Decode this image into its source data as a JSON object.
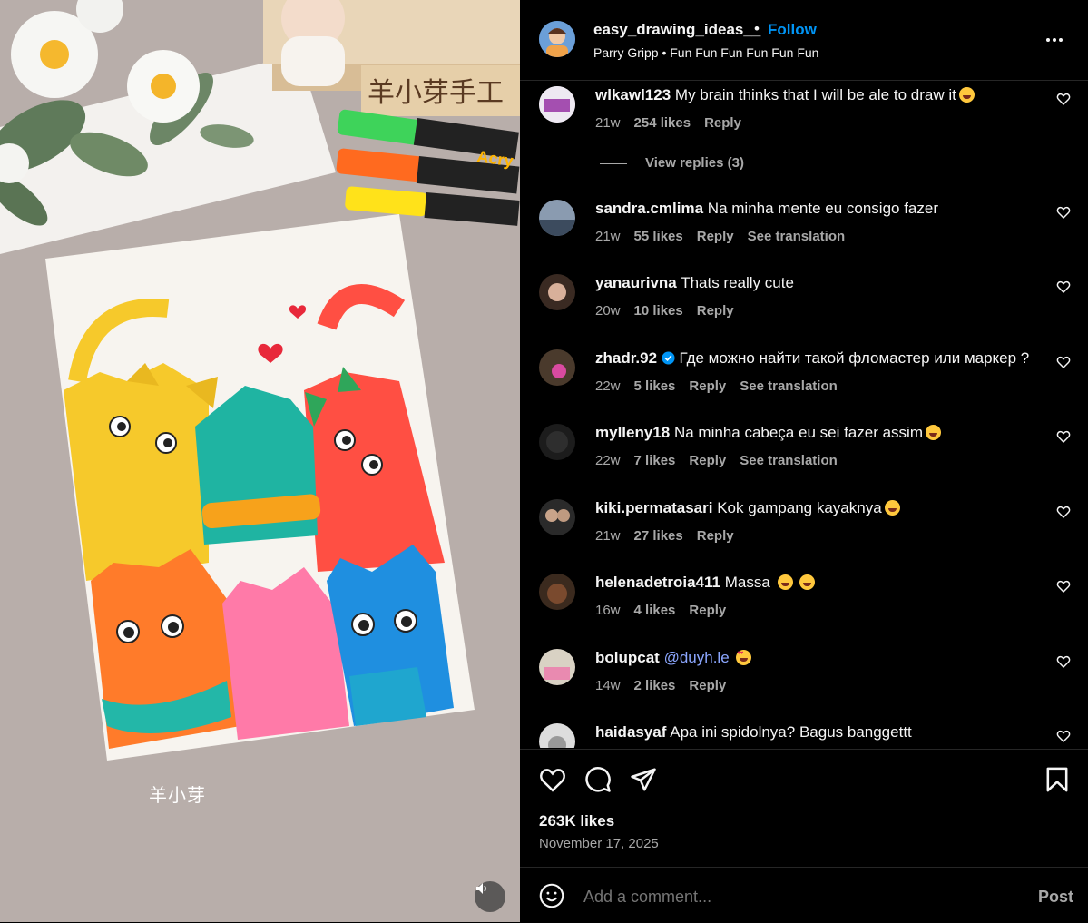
{
  "media": {
    "watermark": "羊小芽",
    "sign_text": "羊小芽手工",
    "marker_brand": "Acry"
  },
  "header": {
    "username": "easy_drawing_ideas__",
    "dot": "•",
    "follow_label": "Follow",
    "audio": "Parry Gripp • Fun Fun Fun Fun Fun Fun"
  },
  "comments": [
    {
      "user": "wlkawl123",
      "text": "My brain thinks that I will be ale to draw it",
      "emoji": true,
      "time": "21w",
      "likes": "254 likes",
      "reply": "Reply",
      "translate": ""
    },
    {
      "user": "sandra.cmlima",
      "text": "Na minha mente eu consigo fazer",
      "time": "21w",
      "likes": "55 likes",
      "reply": "Reply",
      "translate": "See translation"
    },
    {
      "user": "yanaurivna",
      "text": "Thats really cute",
      "time": "20w",
      "likes": "10 likes",
      "reply": "Reply",
      "translate": ""
    },
    {
      "user": "zhadr.92",
      "text": "Где можно найти такой фломастер или маркер ?",
      "time": "22w",
      "likes": "5 likes",
      "reply": "Reply",
      "translate": "See translation"
    },
    {
      "user": "mylleny18",
      "text": "Na minha cabeça eu sei fazer assim",
      "time": "22w",
      "likes": "7 likes",
      "reply": "Reply",
      "translate": "See translation"
    },
    {
      "user": "kiki.permatasari",
      "text": "Kok gampang kayaknya",
      "time": "21w",
      "likes": "27 likes",
      "reply": "Reply",
      "translate": ""
    },
    {
      "user": "helenadetroia411",
      "text": "Massa",
      "time": "16w",
      "likes": "4 likes",
      "reply": "Reply",
      "translate": ""
    },
    {
      "user": "bolupcat",
      "text": "@duyh.le",
      "time": "14w",
      "likes": "2 likes",
      "reply": "Reply",
      "translate": ""
    },
    {
      "user": "haidasyaf",
      "text": "Apa ini spidolnya? Bagus banggettt",
      "time": "",
      "likes": "",
      "reply": "",
      "translate": ""
    }
  ],
  "view_replies": "View replies (3)",
  "footer": {
    "likes": "263K likes",
    "date": "November 17, 2025",
    "add_comment_placeholder": "Add a comment...",
    "post_label": "Post"
  },
  "colors": {
    "follow": "#0095f6",
    "mention": "#8ca7ff",
    "muted": "#a8a8a8"
  },
  "icons": [
    "more-icon",
    "heart-icon",
    "comment-icon",
    "share-icon",
    "bookmark-icon",
    "emoji-icon",
    "volume-icon"
  ]
}
